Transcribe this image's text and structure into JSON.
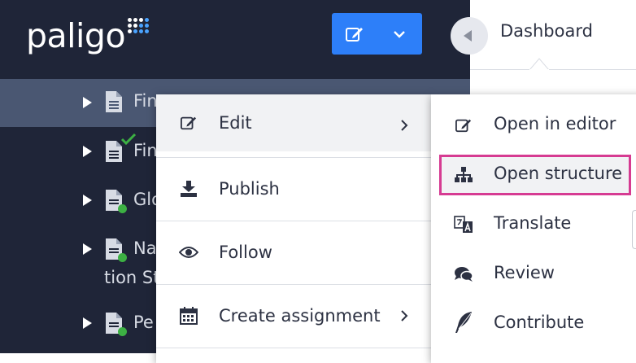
{
  "app": {
    "logo_text": "paligo"
  },
  "dashboard": {
    "label": "Dashboard"
  },
  "tree": {
    "rows": [
      {
        "label": "Fin",
        "status": "none",
        "selected": true
      },
      {
        "label": "Fin",
        "status": "checked"
      },
      {
        "label": "Glo",
        "status": "green-dot"
      },
      {
        "label": "Na",
        "label2": "tion St",
        "status": "green-dot"
      },
      {
        "label": "Pe",
        "status": "green-dot"
      }
    ]
  },
  "context_menu": {
    "items": [
      {
        "label": "Edit",
        "icon": "edit-icon",
        "has_submenu": true
      },
      {
        "label": "Publish",
        "icon": "download-icon",
        "has_submenu": false
      },
      {
        "label": "Follow",
        "icon": "eye-icon",
        "has_submenu": false
      },
      {
        "label": "Create assignment",
        "icon": "calendar-icon",
        "has_submenu": true
      }
    ]
  },
  "submenu": {
    "items": [
      {
        "label": "Open in editor",
        "icon": "edit-icon"
      },
      {
        "label": "Open structure",
        "icon": "sitemap-icon",
        "highlighted": true
      },
      {
        "label": "Translate",
        "icon": "translate-icon"
      },
      {
        "label": "Review",
        "icon": "comments-icon"
      },
      {
        "label": "Contribute",
        "icon": "feather-icon"
      }
    ]
  },
  "colors": {
    "sidebar_bg": "#1f2538",
    "selected_row": "#4a5772",
    "primary_button": "#2d7ff9",
    "highlight_border": "#d63b92",
    "status_green": "#3cb043"
  }
}
